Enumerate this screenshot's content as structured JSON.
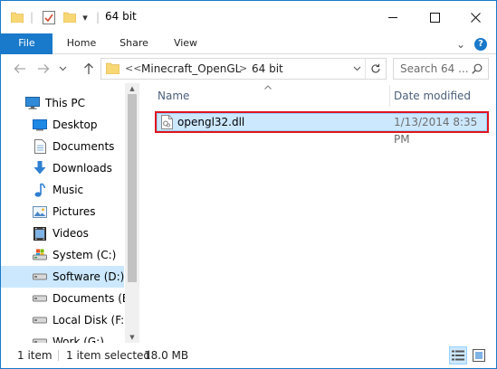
{
  "window": {
    "title": "64 bit",
    "quick_access_separator": "|",
    "customize_arrow": "▾"
  },
  "ribbon": {
    "tabs": [
      "File",
      "Home",
      "Share",
      "View"
    ],
    "collapse_glyph": "⌄",
    "help_glyph": "?"
  },
  "address": {
    "overflow_glyph": "<<",
    "segments": [
      "Minecraft_OpenGL",
      "64 bit"
    ],
    "chevron": ">",
    "search_placeholder": "Search 64 ..."
  },
  "nav": {
    "items": [
      {
        "label": "This PC",
        "icon": "pc-icon"
      },
      {
        "label": "Desktop",
        "icon": "desktop-icon"
      },
      {
        "label": "Documents",
        "icon": "documents-icon"
      },
      {
        "label": "Downloads",
        "icon": "downloads-icon"
      },
      {
        "label": "Music",
        "icon": "music-icon"
      },
      {
        "label": "Pictures",
        "icon": "pictures-icon"
      },
      {
        "label": "Videos",
        "icon": "videos-icon"
      },
      {
        "label": "System (C:)",
        "icon": "drive-icon"
      },
      {
        "label": "Software (D:)",
        "icon": "drive-icon",
        "selected": true
      },
      {
        "label": "Documents (E:",
        "icon": "drive-icon"
      },
      {
        "label": "Local Disk (F:)",
        "icon": "drive-icon"
      },
      {
        "label": "Work (G:)",
        "icon": "drive-icon"
      }
    ]
  },
  "content": {
    "columns": {
      "name": "Name",
      "date": "Date modified"
    },
    "files": [
      {
        "name": "opengl32.dll",
        "date_modified": "1/13/2014 8:35 PM",
        "selected": true,
        "highlighted": true
      }
    ]
  },
  "status": {
    "item_count": "1 item",
    "selection": "1 item selected",
    "size": "18.0 MB"
  },
  "colors": {
    "accent": "#1979ca",
    "selection_bg": "#cce8ff",
    "highlight_border": "#e0141e"
  }
}
